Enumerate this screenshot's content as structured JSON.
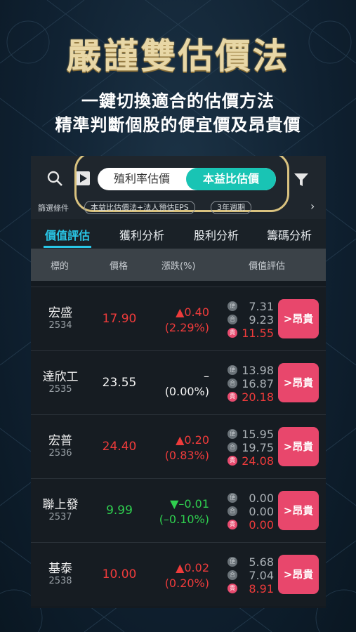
{
  "hero": {
    "title": "嚴謹雙估價法",
    "line1": "一鍵切換適合的估價方法",
    "line2": "精準判斷個股的便宜價及昂貴價"
  },
  "toolbar": {
    "seg_left": "殖利率估價",
    "seg_right": "本益比估價",
    "conditions_label": "篩選條件",
    "chip1": "本益比估價法+法人預估EPS",
    "chip2": "3年週期"
  },
  "tabs": [
    "價值評估",
    "獲利分析",
    "股利分析",
    "籌碼分析"
  ],
  "headers": {
    "symbol": "標的",
    "price": "價格",
    "change": "漲跌(%)",
    "valuation": "價值評估"
  },
  "rows": [
    {
      "name": "宏盛",
      "code": "2534",
      "price": "17.90",
      "change": "▲0.40",
      "pct": "(2.29%)",
      "dir": "up",
      "v1": "7.31",
      "v2": "9.23",
      "v3": "11.55",
      "btn": ">昂貴"
    },
    {
      "name": "達欣工",
      "code": "2535",
      "price": "23.55",
      "change": "–",
      "pct": "(0.00%)",
      "dir": "flat",
      "v1": "13.98",
      "v2": "16.87",
      "v3": "20.18",
      "btn": ">昂貴"
    },
    {
      "name": "宏普",
      "code": "2536",
      "price": "24.40",
      "change": "▲0.20",
      "pct": "(0.83%)",
      "dir": "up",
      "v1": "15.95",
      "v2": "19.75",
      "v3": "24.08",
      "btn": ">昂貴"
    },
    {
      "name": "聯上發",
      "code": "2537",
      "price": "9.99",
      "change": "▼–0.01",
      "pct": "(–0.10%)",
      "dir": "down",
      "v1": "0.00",
      "v2": "0.00",
      "v3": "0.00",
      "btn": ">昂貴"
    },
    {
      "name": "基泰",
      "code": "2538",
      "price": "10.00",
      "change": "▲0.02",
      "pct": "(0.20%)",
      "dir": "up",
      "v1": "5.68",
      "v2": "7.04",
      "v3": "8.91",
      "btn": ">昂貴"
    }
  ],
  "badges": {
    "b1": "便",
    "b2": "合",
    "b3": "貴"
  },
  "colors": {
    "accent": "#19c4b4",
    "tab_active": "#29c6e6",
    "expensive": "#e8476c",
    "gold": "#d9c27f"
  }
}
